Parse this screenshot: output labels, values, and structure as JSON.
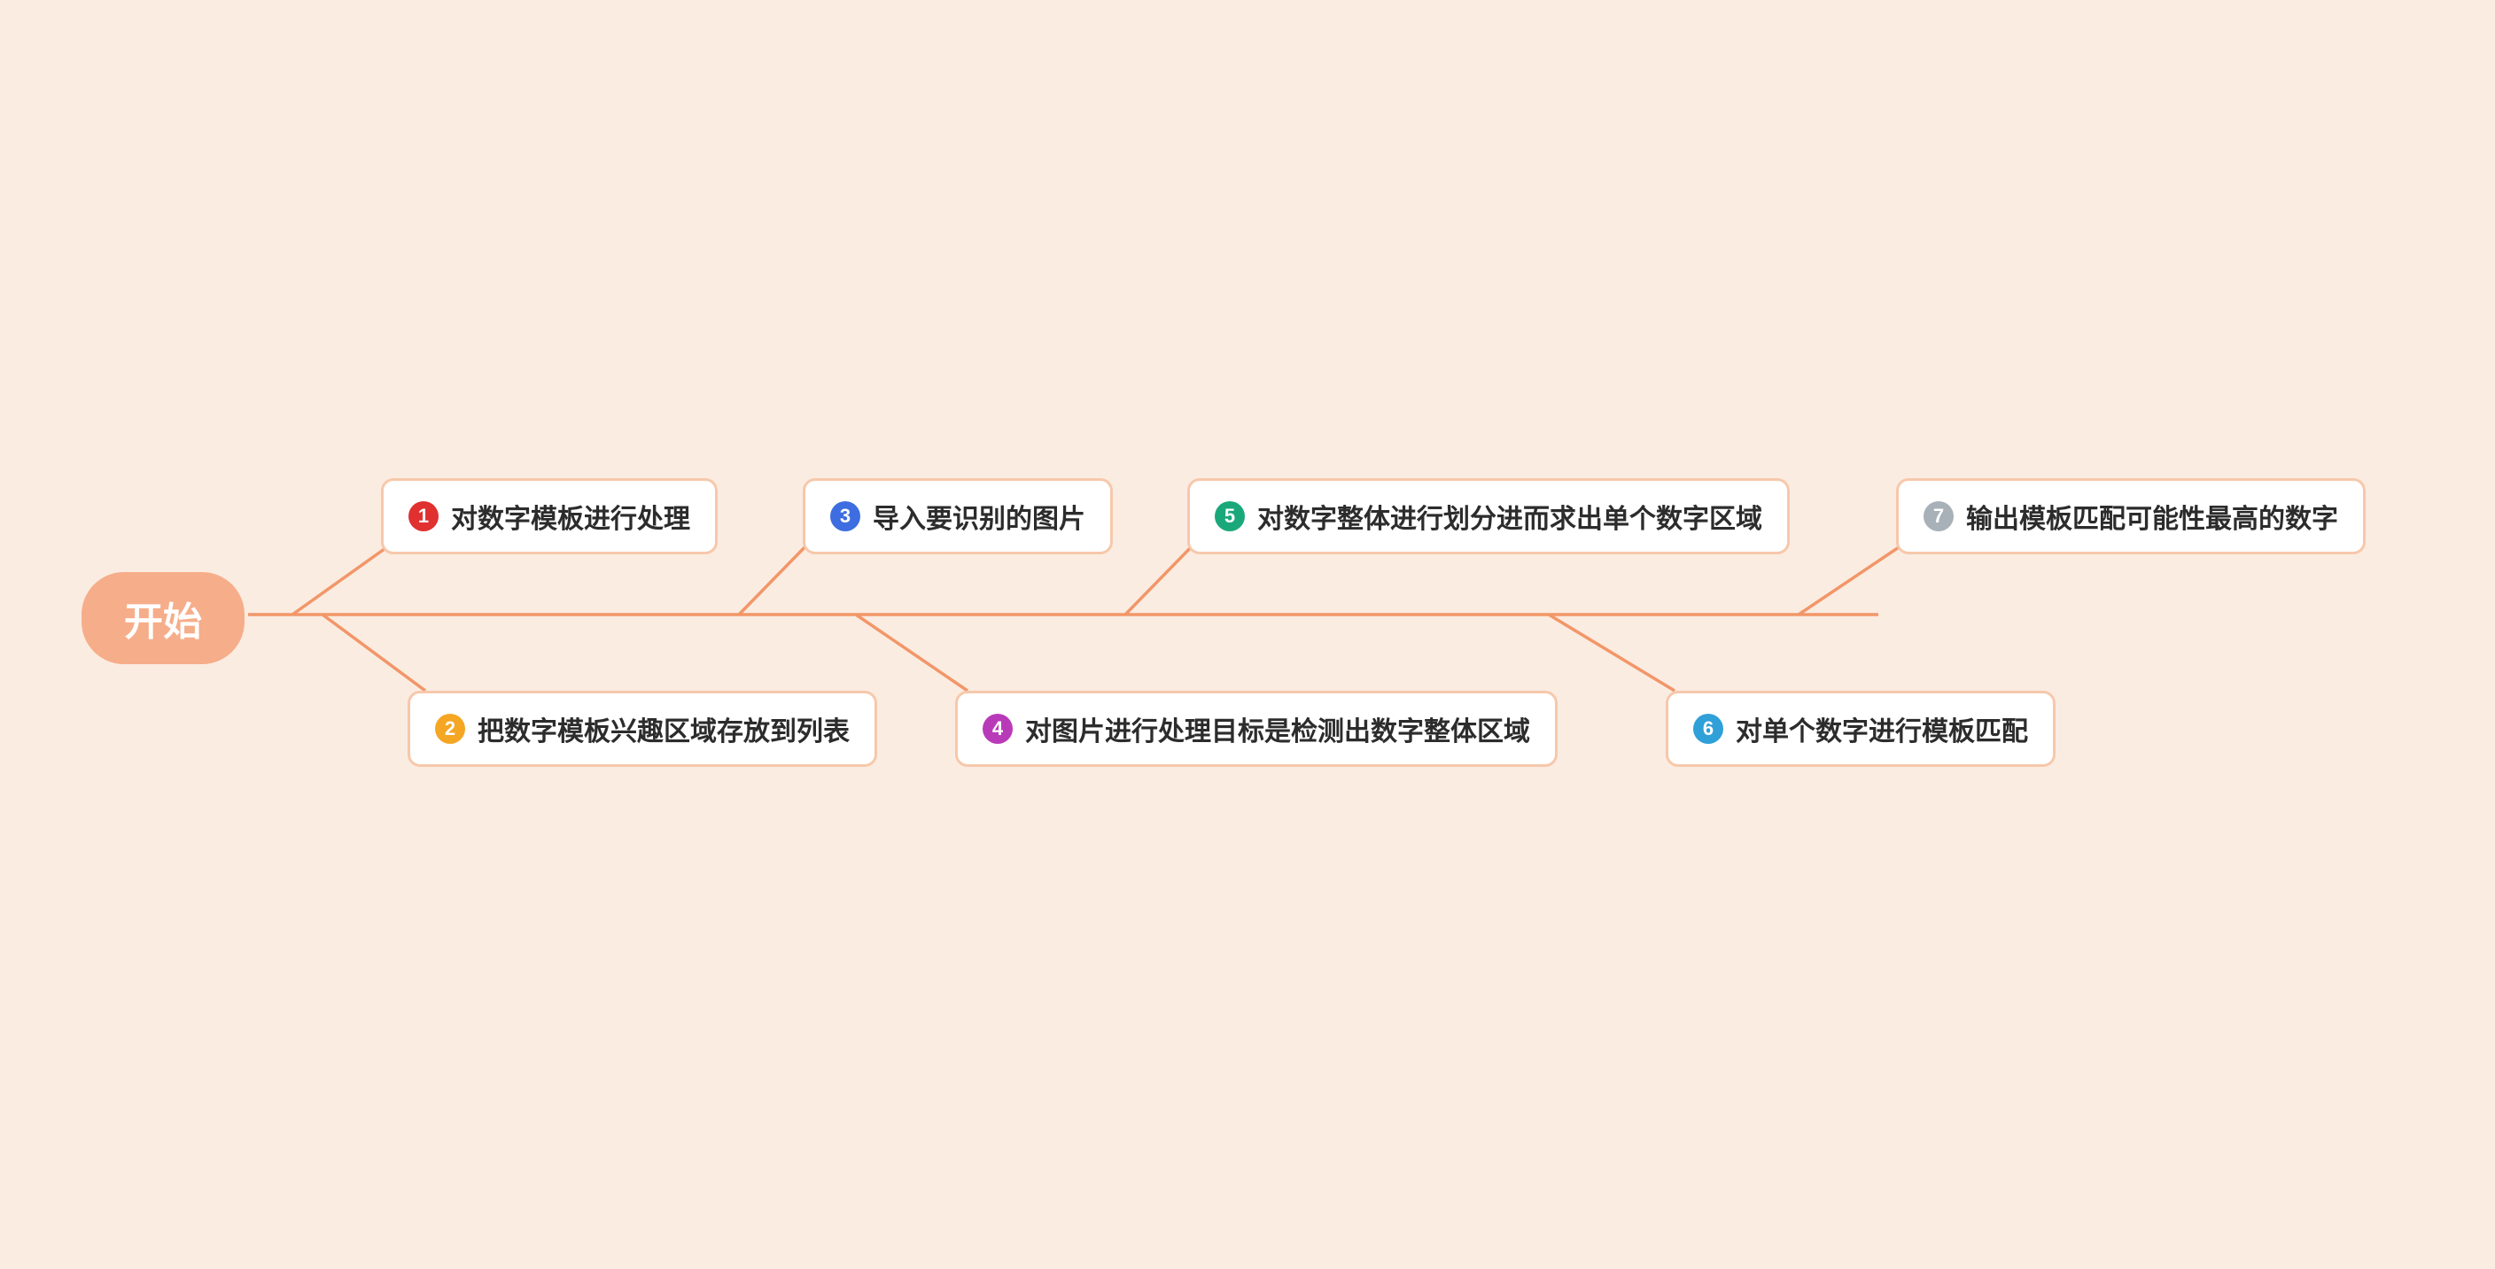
{
  "root": {
    "label": "开始"
  },
  "steps": [
    {
      "num": "1",
      "text": "对数字模板进行处理",
      "color": "#e03030"
    },
    {
      "num": "2",
      "text": "把数字模板兴趣区域存放到列表",
      "color": "#f5a623"
    },
    {
      "num": "3",
      "text": "导入要识别的图片",
      "color": "#3d6de0"
    },
    {
      "num": "4",
      "text": "对图片进行处理目标是检测出数字整体区域",
      "color": "#b93ab9"
    },
    {
      "num": "5",
      "text": "对数字整体进行划分进而求出单个数字区域",
      "color": "#1aa87a"
    },
    {
      "num": "6",
      "text": "对单个数字进行模板匹配",
      "color": "#2fa0d8"
    },
    {
      "num": "7",
      "text": "输出模板匹配可能性最高的数字",
      "color": "#a8b0b8"
    }
  ],
  "colors": {
    "background": "#fbece1",
    "spine": "#f29668",
    "rootFill": "#f6ad89",
    "nodeBorder": "#f6c8ab",
    "nodeBg": "#ffffff"
  }
}
